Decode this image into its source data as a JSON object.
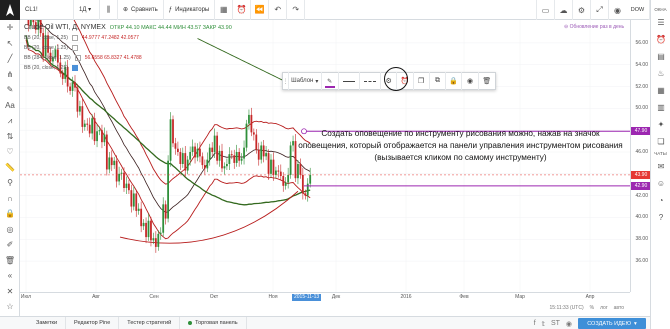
{
  "topbar": {
    "symbol": "CL1!",
    "interval": "1Д",
    "compare_label": "Сравнить",
    "indicators_label": "Индикаторы",
    "dow_label": "DOW"
  },
  "legend": {
    "title": "Crude Oil WTI, Д, NYMEX",
    "ohlc": "ОТКР 44.10  МАКС 44.44  МИН 43.57  ЗАКР 43.90",
    "bb1_label": "BB (20, close, 1.25)",
    "bb1_values": "44.9777  47.2482  42.0577",
    "bb2_label": "BB (20, close, 1.25)",
    "bb3_label": "BB (284, close, 1.25)",
    "bb3_values": "56.6558  65.8327  41.4788",
    "bb4_label": "BB (20, close, 1.25)"
  },
  "alert_indicator": "Обновление раз в день",
  "drawing_toolbar": {
    "template_label": "Шаблон"
  },
  "annotation": "Создать оповещение по инструменту рисования можно, нажав на значок оповещения, который отображается на панели управления инструментом рисования (вызывается кликом по самому инструменту)",
  "price_axis": {
    "ticks": [
      "56.00",
      "54.00",
      "52.00",
      "50.00",
      "48.00",
      "46.00",
      "44.00",
      "42.00",
      "40.00",
      "38.00",
      "36.00"
    ],
    "labels": [
      {
        "text": "47.90",
        "color": "#9c27b0"
      },
      {
        "text": "43.90",
        "color": "#e53935"
      },
      {
        "text": "42.90",
        "color": "#9c27b0"
      }
    ]
  },
  "time_axis": {
    "ticks": [
      "Июл",
      "Авг",
      "Сен",
      "Окт",
      "Ноя",
      "Дек",
      "2016",
      "Фев",
      "Мар",
      "Апр"
    ],
    "cursor": "2015-11-13"
  },
  "info_row": {
    "clock": "15:11:33 (UTC)",
    "items": [
      "%",
      "лог",
      "авто"
    ]
  },
  "rightbar": {
    "label_top": "ОКНА",
    "label_chat": "ЧАТЫ"
  },
  "bottom_panel": {
    "tabs": [
      "Заметки",
      "Редактор Pine",
      "Тестер стратегий",
      "Торговая панель"
    ],
    "create_button": "СОЗДАТЬ ИДЕЮ"
  },
  "colors": {
    "accent": "#3e8fd8",
    "up_candle": "#2f8f3a",
    "down_candle": "#c62828",
    "bb_red": "#b71c1c",
    "bb_green": "#33691e",
    "alert_line": "#9c27b0"
  },
  "chart_data": {
    "type": "candlestick",
    "ylim": [
      35,
      57
    ],
    "x_start": "2015-06",
    "closes": [
      59.5,
      57.6,
      58.3,
      57.9,
      57.2,
      58.1,
      56.9,
      54.8,
      56.7,
      55.1,
      54.3,
      54.7,
      55.4,
      54.2,
      53.2,
      52.7,
      53.8,
      52.0,
      51.6,
      52.4,
      51.9,
      49.7,
      50.2,
      48.3,
      48.6,
      48.5,
      47.7,
      49.1,
      47.0,
      47.9,
      48.0,
      46.9,
      47.6,
      44.4,
      45.5,
      44.8,
      45.2,
      43.3,
      44.0,
      44.1,
      42.7,
      43.1,
      42.5,
      41.0,
      42.2,
      40.6,
      40.8,
      39.2,
      39.5,
      38.2,
      39.7,
      37.9,
      38.1,
      37.3,
      38.5,
      38.6,
      41.2,
      39.9,
      45.2,
      49.0,
      46.8,
      46.3,
      46.0,
      44.9,
      45.9,
      44.3,
      45.3,
      46.0,
      46.5,
      45.5,
      46.3,
      45.6,
      44.8,
      44.5,
      45.3,
      46.4,
      46.0,
      47.5,
      45.2,
      46.1,
      44.5,
      44.7,
      44.9,
      45.8,
      45.7,
      45.0,
      46.0,
      45.2,
      45.4,
      46.4,
      48.6,
      49.4,
      47.8,
      47.6,
      46.2,
      45.3,
      46.6,
      45.6,
      45.9,
      44.0,
      45.3,
      43.9,
      44.3,
      44.2,
      43.8,
      42.9,
      43.2,
      43.9,
      46.6,
      47.0,
      43.6,
      44.9,
      43.9,
      42.2,
      42.0,
      43.1,
      43.9
    ]
  }
}
